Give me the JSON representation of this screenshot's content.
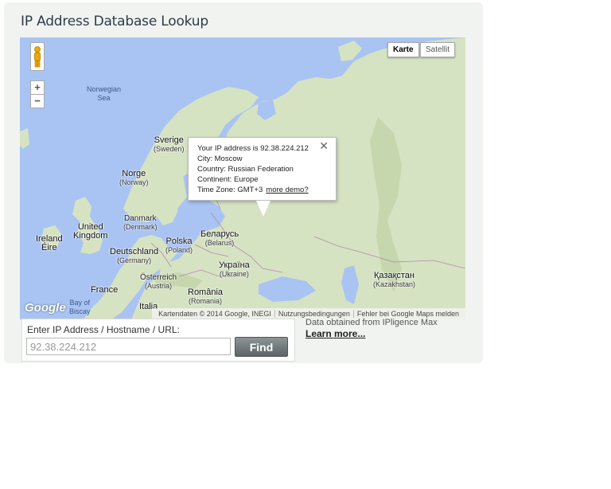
{
  "page": {
    "title": "IP Address Database Lookup"
  },
  "map": {
    "type_buttons": {
      "map": "Karte",
      "satellite": "Satellit"
    },
    "zoom": {
      "in": "+",
      "out": "−"
    },
    "labels": {
      "norwegian_sea": "Norwegian\nSea",
      "sverige": "Sverige",
      "sverige_sub": "(Sweden)",
      "norge": "Norge",
      "norge_sub": "(Norway)",
      "danmark": "Danmark",
      "danmark_sub": "(Denmark)",
      "uk": "United\nKingdom",
      "ireland": "Ireland\nÉire",
      "deutschland": "Deutschland",
      "deutschland_sub": "(Germany)",
      "polska": "Polska",
      "polska_sub": "(Poland)",
      "belarus": "Беларусь",
      "belarus_sub": "(Belarus)",
      "ukraine": "Україна",
      "ukraine_sub": "(Ukraine)",
      "oesterreich": "Österreich",
      "oesterreich_sub": "(Austria)",
      "romania": "România",
      "romania_sub": "(Romania)",
      "france": "France",
      "biscay": "Bay of\nBiscay",
      "italia": "Italia",
      "kazakhstan": "Қазақстан",
      "kazakhstan_sub": "(Kazakhstan)"
    },
    "info_window": {
      "ip_line": "Your IP address is 92.38.224.212",
      "city_line": "City: Moscow",
      "country_line": "Country: Russian Federation",
      "continent_line": "Continent: Europe",
      "timezone_line": "Time Zone: GMT+3",
      "more_demo": "more demo?",
      "close": "✕"
    },
    "logo": "Google",
    "footer": {
      "attribution": "Kartendaten © 2014 Google, INEGI",
      "terms": "Nutzungsbedingungen",
      "report": "Fehler bei Google Maps melden"
    }
  },
  "lookup": {
    "label": "Enter IP Address / Hostname / URL:",
    "input_value": "92.38.224.212",
    "find_label": "Find"
  },
  "source": {
    "text": "Data obtained from IPligence Max",
    "learn_more": "Learn more..."
  }
}
